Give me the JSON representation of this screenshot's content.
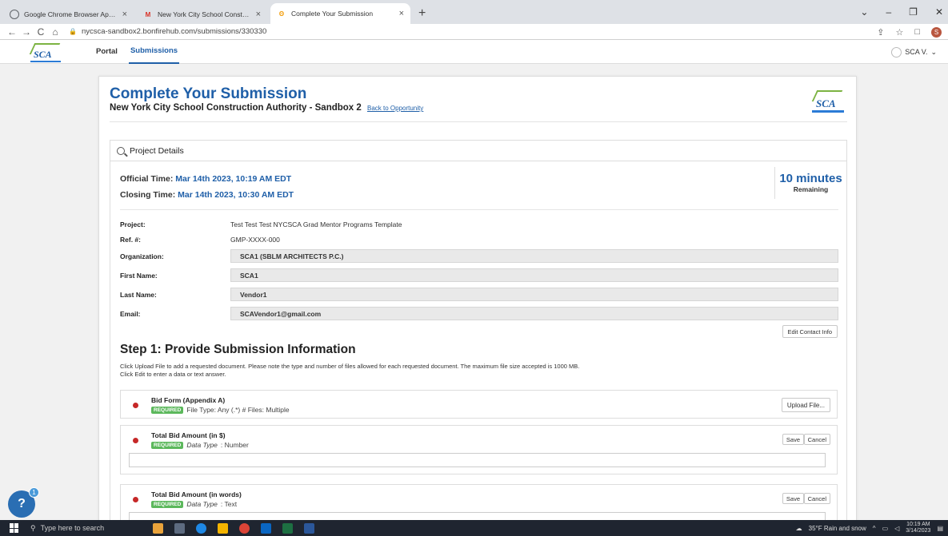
{
  "browser": {
    "tabs": [
      {
        "title": "Google Chrome Browser Applica",
        "icon": "chrome-icon",
        "color": "#5f6368",
        "active": false
      },
      {
        "title": "New York City School Constructi",
        "icon": "gmail-icon",
        "color": "#d93025",
        "active": false
      },
      {
        "title": "Complete Your Submission",
        "icon": "bonfire-icon",
        "color": "#f29900",
        "active": true
      }
    ],
    "url": "nycsca-sandbox2.bonfirehub.com/submissions/330330"
  },
  "app": {
    "logo_text": "SCA",
    "nav": [
      "Portal",
      "Submissions"
    ],
    "user": "SCA V."
  },
  "card": {
    "title": "Complete Your Submission",
    "org": "New York City School Construction Authority - Sandbox 2",
    "back_link": "Back to Opportunity",
    "logo_text": "SCA"
  },
  "details": {
    "header": "Project Details",
    "official_label": "Official Time:",
    "official_value": "Mar 14th 2023, 10:19 AM EDT",
    "closing_label": "Closing Time:",
    "closing_value": "Mar 14th 2023, 10:30 AM EDT",
    "remaining_value": "10 minutes",
    "remaining_label": "Remaining",
    "fields": [
      {
        "label": "Project:",
        "value": "Test Test Test NYCSCA Grad Mentor Programs Template",
        "boxed": false
      },
      {
        "label": "Ref. #:",
        "value": "GMP-XXXX-000",
        "boxed": false
      },
      {
        "label": "Organization:",
        "value": "SCA1 (SBLM ARCHITECTS P.C.)",
        "boxed": true
      },
      {
        "label": "First Name:",
        "value": "SCA1",
        "boxed": true
      },
      {
        "label": "Last Name:",
        "value": "Vendor1",
        "boxed": true
      },
      {
        "label": "Email:",
        "value": "SCAVendor1@gmail.com",
        "boxed": true
      }
    ],
    "edit_contact": "Edit Contact Info"
  },
  "step1": {
    "title": "Step 1: Provide Submission Information",
    "desc1": "Click Upload File to add a requested document. Please note the type and number of files allowed for each requested document. The maximum file size accepted is 1000 MB.",
    "desc2": "Click Edit to enter a data or text answer.",
    "items": [
      {
        "name": "Bid Form (Appendix A)",
        "badge": "REQUIRED",
        "meta": "File Type: Any (.*)  # Files: Multiple",
        "action": "Upload File..."
      },
      {
        "name": "Total Bid Amount (in $)",
        "badge": "REQUIRED",
        "meta_italic": "Data Type",
        "meta_value": ": Number",
        "save": "Save",
        "cancel": "Cancel"
      },
      {
        "name": "Total Bid Amount (in words)",
        "badge": "REQUIRED",
        "meta_italic": "Data Type",
        "meta_value": ": Text",
        "save": "Save",
        "cancel": "Cancel"
      }
    ]
  },
  "help": {
    "label": "?",
    "count": "1"
  },
  "taskbar": {
    "search_placeholder": "Type here to search",
    "weather": "35°F  Rain and snow",
    "time": "10:19 AM",
    "date": "3/14/2023"
  }
}
